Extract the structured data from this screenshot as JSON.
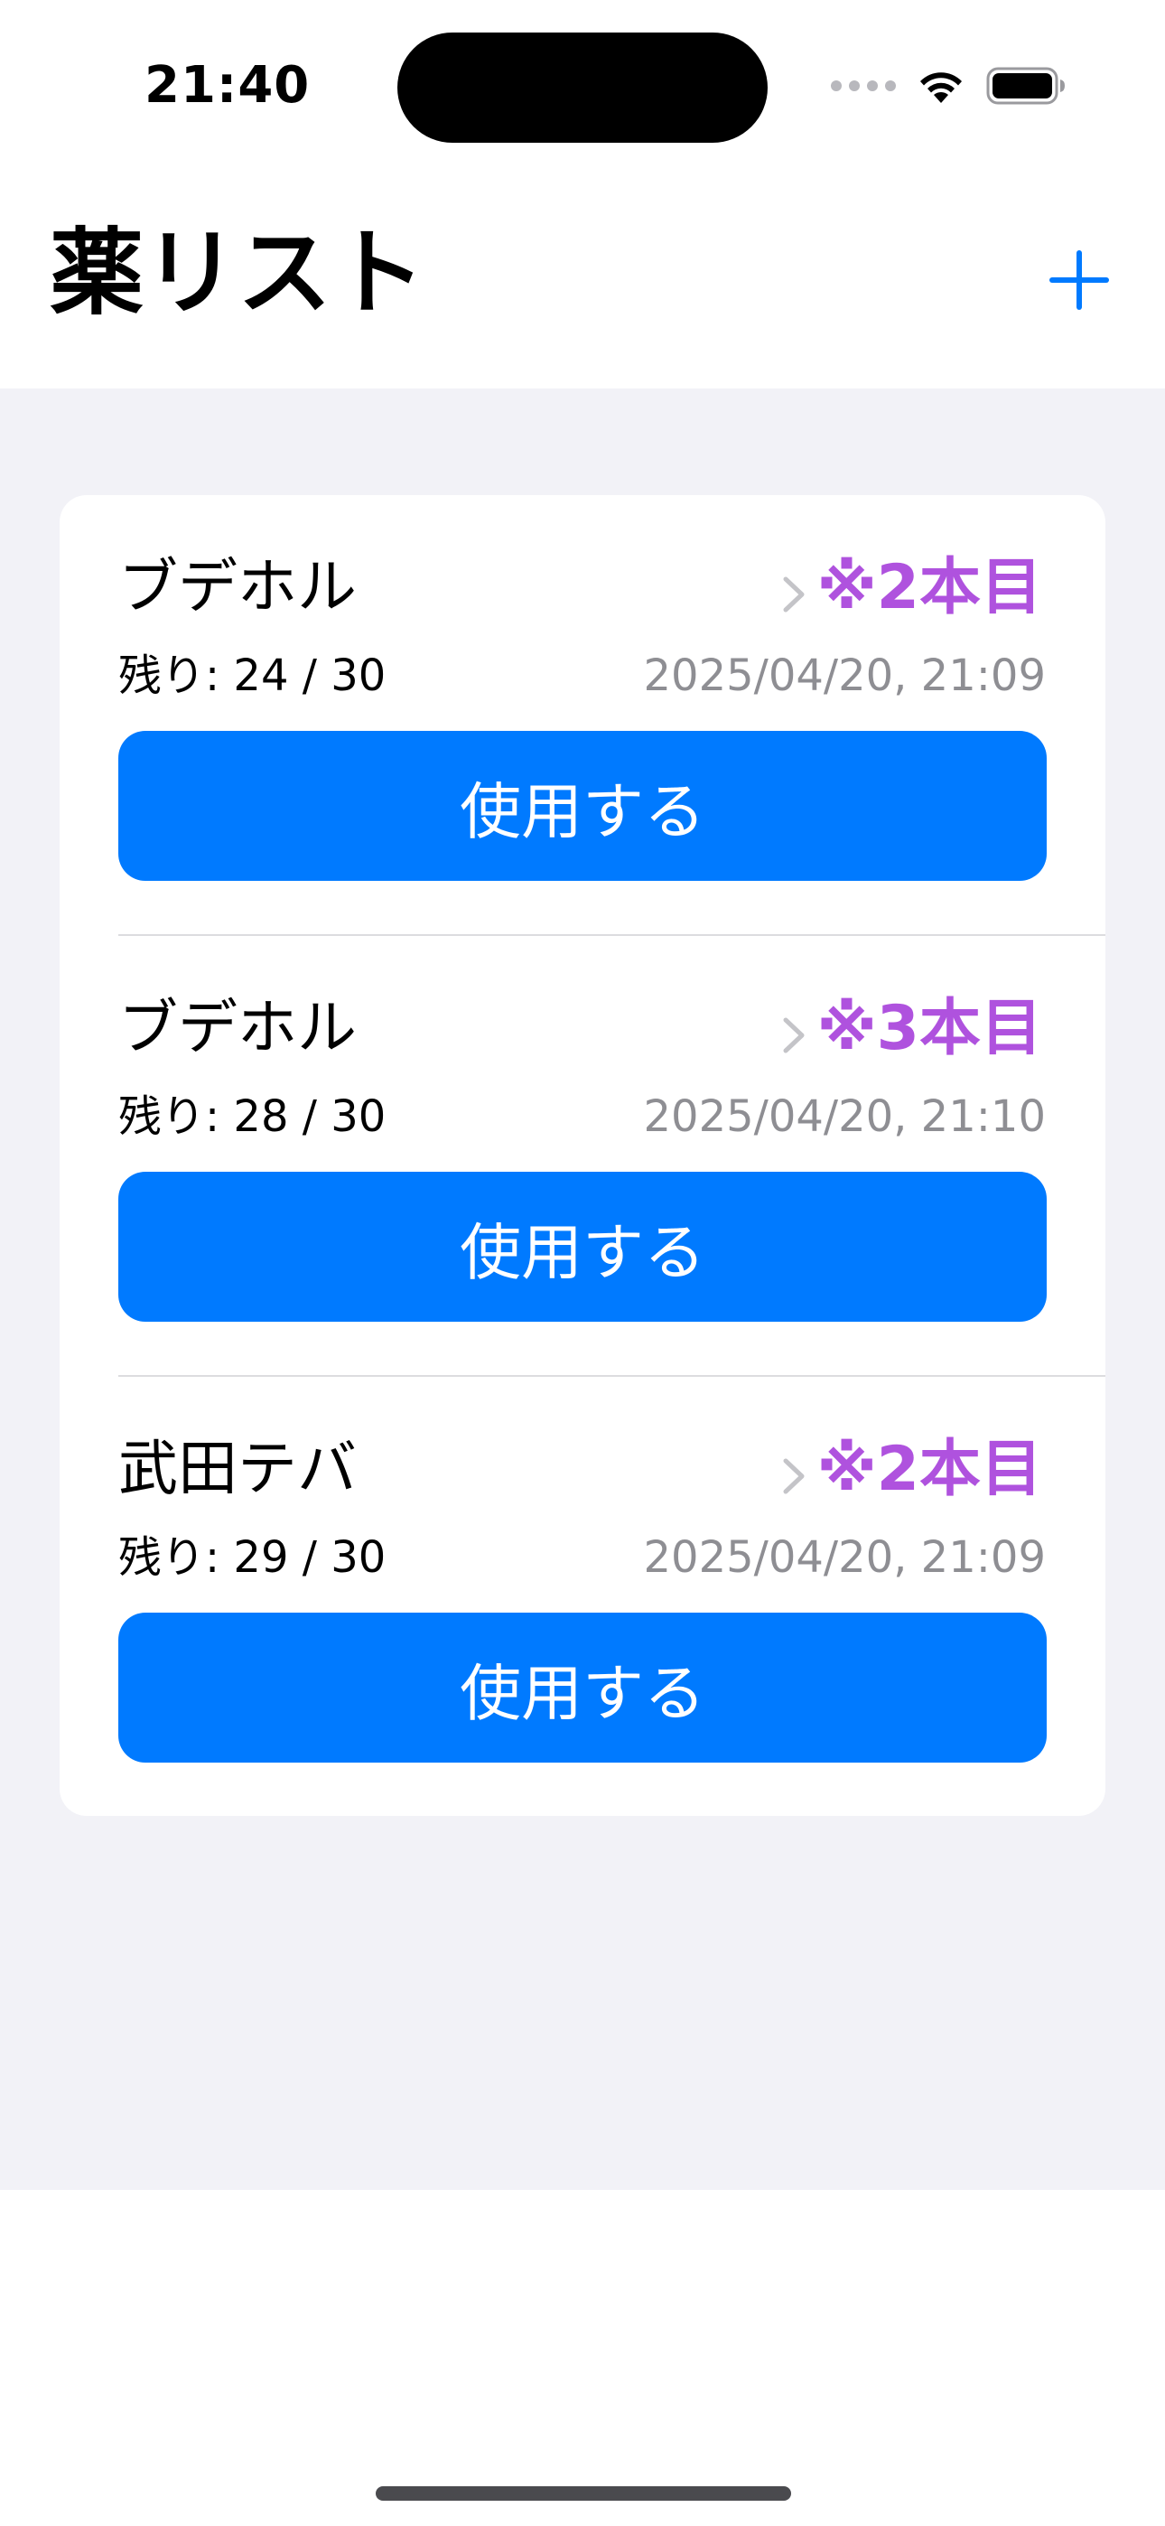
{
  "status_bar": {
    "time": "21:40",
    "icons": [
      "signal-dots-icon",
      "wifi-icon",
      "battery-icon"
    ]
  },
  "header": {
    "title": "薬リスト",
    "add_icon": "plus-icon"
  },
  "colors": {
    "accent": "#007aff",
    "badge": "#af52de",
    "secondary_text": "#8e8e93",
    "background": "#f2f2f7"
  },
  "medicines": [
    {
      "name": "ブデホル",
      "count_label": "※2本目",
      "remaining": "残り: 24 / 30",
      "timestamp": "2025/04/20, 21:09",
      "button_label": "使用する"
    },
    {
      "name": "ブデホル",
      "count_label": "※3本目",
      "remaining": "残り: 28 / 30",
      "timestamp": "2025/04/20, 21:10",
      "button_label": "使用する"
    },
    {
      "name": "武田テバ",
      "count_label": "※2本目",
      "remaining": "残り: 29 / 30",
      "timestamp": "2025/04/20, 21:09",
      "button_label": "使用する"
    }
  ]
}
